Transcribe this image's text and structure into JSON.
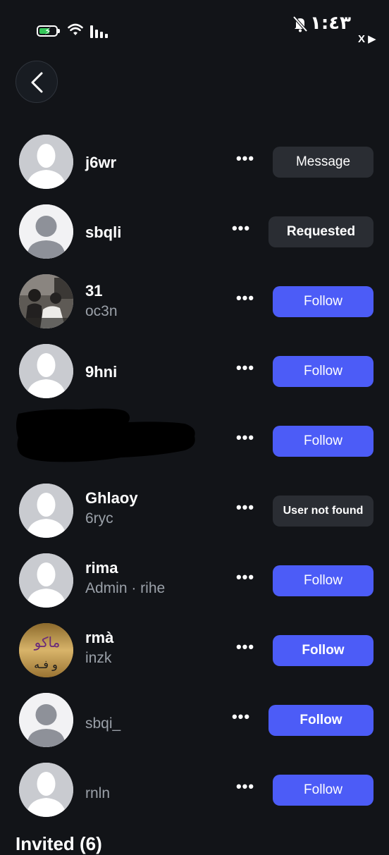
{
  "status_bar": {
    "time": "١:٤٣",
    "indicator": "X ▶",
    "icons": [
      "battery-charging-icon",
      "wifi-icon",
      "cellular-signal-icon",
      "bell-mute-icon"
    ],
    "battery_color": "#34c759"
  },
  "header": {
    "back_icon": "chevron-left-icon"
  },
  "colors": {
    "background": "#121418",
    "follow_button": "#4c5cf7",
    "secondary_button": "#2a2d33",
    "secondary_text": "#9aa0a8"
  },
  "users": [
    {
      "name": "j6wr",
      "subtitle": "",
      "action": "Message",
      "more": "•••"
    },
    {
      "name": "sbqli",
      "subtitle": "",
      "action": "Requested",
      "more": "•••"
    },
    {
      "name": "31",
      "subtitle": "oc3n",
      "action": "Follow",
      "more": "•••"
    },
    {
      "name": "9hni",
      "subtitle": "",
      "action": "Follow",
      "more": "•••"
    },
    {
      "name": "",
      "subtitle": "",
      "action": "Follow",
      "more": "•••"
    },
    {
      "name": "Ghlaoy",
      "subtitle": "6ryc",
      "action": "User not found",
      "more": "•••"
    },
    {
      "name": "rima",
      "subtitle": "Admin · rihe",
      "action": "Follow",
      "more": "•••"
    },
    {
      "name": "rmà",
      "subtitle": "inzk",
      "action": "Follow",
      "more": "•••",
      "avatar_text_top": "ماكو",
      "avatar_text_bottom": "و فـه"
    },
    {
      "name": "",
      "subtitle": "sbqi_",
      "action": "Follow",
      "more": "•••"
    },
    {
      "name": "",
      "subtitle": "rnln",
      "action": "Follow",
      "more": "•••"
    }
  ],
  "footer": {
    "partial_heading": "Invited (6)"
  }
}
